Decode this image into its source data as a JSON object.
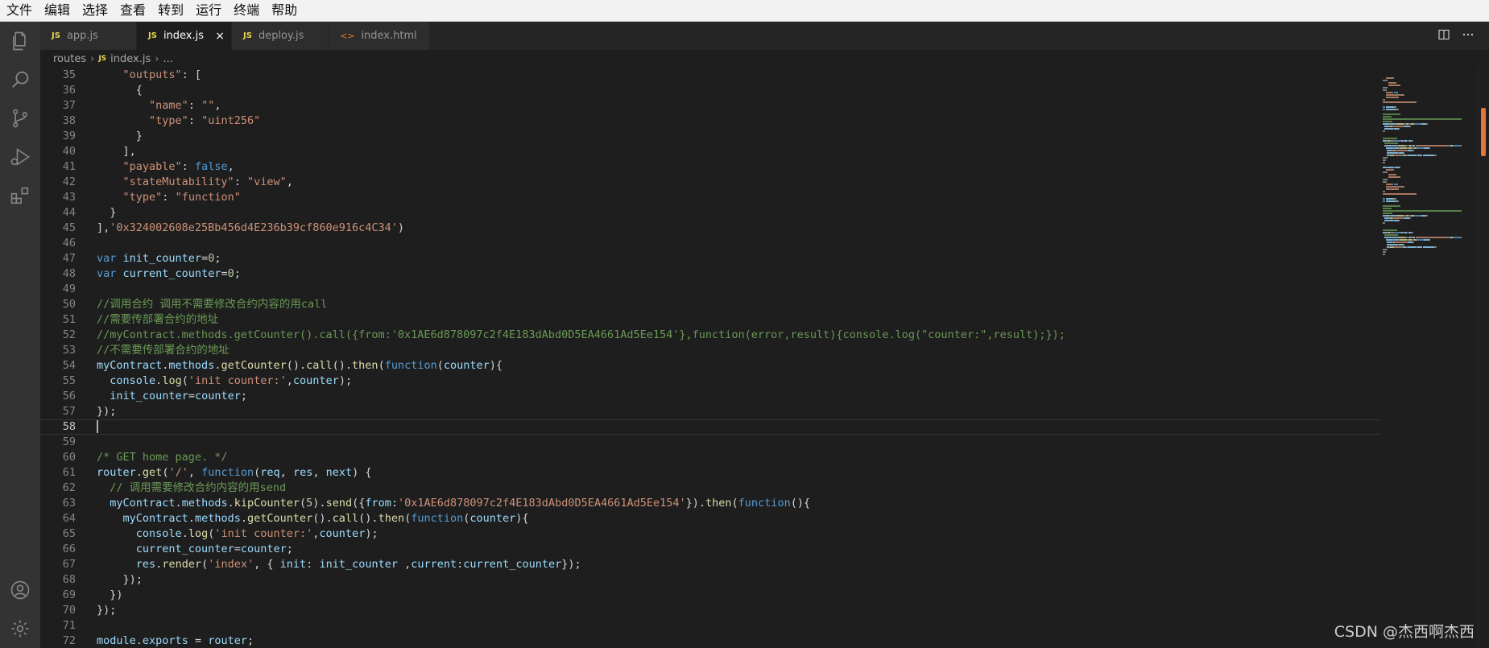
{
  "menu": [
    "文件",
    "编辑",
    "选择",
    "查看",
    "转到",
    "运行",
    "终端",
    "帮助"
  ],
  "tabs": [
    {
      "label": "app.js",
      "icon": "JS"
    },
    {
      "label": "index.js",
      "icon": "JS",
      "close": "×"
    },
    {
      "label": "deploy.js",
      "icon": "JS"
    },
    {
      "label": "index.html",
      "icon": "<>"
    }
  ],
  "breadcrumb": {
    "folder": "routes",
    "file_icon": "JS",
    "file": "index.js",
    "more": "..."
  },
  "lines": [
    {
      "n": "35",
      "segs": [
        [
          "    ",
          "p"
        ],
        [
          "\"outputs\"",
          "k"
        ],
        [
          ": [",
          "p"
        ]
      ]
    },
    {
      "n": "36",
      "segs": [
        [
          "      {",
          "p"
        ]
      ]
    },
    {
      "n": "37",
      "segs": [
        [
          "        ",
          "p"
        ],
        [
          "\"name\"",
          "k"
        ],
        [
          ": ",
          "p"
        ],
        [
          "\"\"",
          "s"
        ],
        [
          ",",
          "p"
        ]
      ]
    },
    {
      "n": "38",
      "segs": [
        [
          "        ",
          "p"
        ],
        [
          "\"type\"",
          "k"
        ],
        [
          ": ",
          "p"
        ],
        [
          "\"uint256\"",
          "s"
        ]
      ]
    },
    {
      "n": "39",
      "segs": [
        [
          "      }",
          "p"
        ]
      ]
    },
    {
      "n": "40",
      "segs": [
        [
          "    ],",
          "p"
        ]
      ]
    },
    {
      "n": "41",
      "segs": [
        [
          "    ",
          "p"
        ],
        [
          "\"payable\"",
          "k"
        ],
        [
          ": ",
          "p"
        ],
        [
          "false",
          "w"
        ],
        [
          ",",
          "p"
        ]
      ]
    },
    {
      "n": "42",
      "segs": [
        [
          "    ",
          "p"
        ],
        [
          "\"stateMutability\"",
          "k"
        ],
        [
          ": ",
          "p"
        ],
        [
          "\"view\"",
          "s"
        ],
        [
          ",",
          "p"
        ]
      ]
    },
    {
      "n": "43",
      "segs": [
        [
          "    ",
          "p"
        ],
        [
          "\"type\"",
          "k"
        ],
        [
          ": ",
          "p"
        ],
        [
          "\"function\"",
          "s"
        ]
      ]
    },
    {
      "n": "44",
      "segs": [
        [
          "  }",
          "p"
        ]
      ]
    },
    {
      "n": "45",
      "segs": [
        [
          "],",
          "p"
        ],
        [
          "'0x324002608e25Bb456d4E236b39cf860e916c4C34'",
          "s"
        ],
        [
          ")",
          "p"
        ]
      ]
    },
    {
      "n": "46",
      "segs": []
    },
    {
      "n": "47",
      "segs": [
        [
          "var",
          "w"
        ],
        [
          " ",
          "p"
        ],
        [
          "init_counter",
          "v"
        ],
        [
          "=",
          "p"
        ],
        [
          "0",
          "n"
        ],
        [
          ";",
          "p"
        ]
      ]
    },
    {
      "n": "48",
      "segs": [
        [
          "var",
          "w"
        ],
        [
          " ",
          "p"
        ],
        [
          "current_counter",
          "v"
        ],
        [
          "=",
          "p"
        ],
        [
          "0",
          "n"
        ],
        [
          ";",
          "p"
        ]
      ]
    },
    {
      "n": "49",
      "segs": []
    },
    {
      "n": "50",
      "segs": [
        [
          "//调用合约 调用不需要修改合约内容的用call",
          "c"
        ]
      ]
    },
    {
      "n": "51",
      "segs": [
        [
          "//需要传部署合约的地址",
          "c"
        ]
      ]
    },
    {
      "n": "52",
      "segs": [
        [
          "//myContract.methods.getCounter().call({from:'0x1AE6d878097c2f4E183dAbd0D5EA4661Ad5Ee154'},function(error,result){console.log(\"counter:\",result);});",
          "c"
        ]
      ]
    },
    {
      "n": "53",
      "segs": [
        [
          "//不需要传部署合约的地址",
          "c"
        ]
      ]
    },
    {
      "n": "54",
      "segs": [
        [
          "myContract",
          "v"
        ],
        [
          ".",
          "p"
        ],
        [
          "methods",
          "v"
        ],
        [
          ".",
          "p"
        ],
        [
          "getCounter",
          "f"
        ],
        [
          "().",
          "p"
        ],
        [
          "call",
          "f"
        ],
        [
          "().",
          "p"
        ],
        [
          "then",
          "f"
        ],
        [
          "(",
          "p"
        ],
        [
          "function",
          "w"
        ],
        [
          "(",
          "p"
        ],
        [
          "counter",
          "v"
        ],
        [
          "){",
          "p"
        ]
      ]
    },
    {
      "n": "55",
      "segs": [
        [
          "  ",
          "p"
        ],
        [
          "console",
          "v"
        ],
        [
          ".",
          "p"
        ],
        [
          "log",
          "f"
        ],
        [
          "(",
          "p"
        ],
        [
          "'init counter:'",
          "s"
        ],
        [
          ",",
          "p"
        ],
        [
          "counter",
          "v"
        ],
        [
          ");",
          "p"
        ]
      ]
    },
    {
      "n": "56",
      "segs": [
        [
          "  ",
          "p"
        ],
        [
          "init_counter",
          "v"
        ],
        [
          "=",
          "p"
        ],
        [
          "counter",
          "v"
        ],
        [
          ";",
          "p"
        ]
      ]
    },
    {
      "n": "57",
      "segs": [
        [
          "});",
          "p"
        ]
      ]
    },
    {
      "n": "58",
      "segs": [],
      "current": true
    },
    {
      "n": "59",
      "segs": []
    },
    {
      "n": "60",
      "segs": [
        [
          "/* GET home page. */",
          "c"
        ]
      ]
    },
    {
      "n": "61",
      "segs": [
        [
          "router",
          "v"
        ],
        [
          ".",
          "p"
        ],
        [
          "get",
          "f"
        ],
        [
          "(",
          "p"
        ],
        [
          "'/'",
          "s"
        ],
        [
          ", ",
          "p"
        ],
        [
          "function",
          "w"
        ],
        [
          "(",
          "p"
        ],
        [
          "req",
          "v"
        ],
        [
          ", ",
          "p"
        ],
        [
          "res",
          "v"
        ],
        [
          ", ",
          "p"
        ],
        [
          "next",
          "v"
        ],
        [
          ") {",
          "p"
        ]
      ]
    },
    {
      "n": "62",
      "segs": [
        [
          "  ",
          "p"
        ],
        [
          "// 调用需要修改合约内容的用send",
          "c"
        ]
      ]
    },
    {
      "n": "63",
      "segs": [
        [
          "  ",
          "p"
        ],
        [
          "myContract",
          "v"
        ],
        [
          ".",
          "p"
        ],
        [
          "methods",
          "v"
        ],
        [
          ".",
          "p"
        ],
        [
          "kipCounter",
          "f"
        ],
        [
          "(",
          "p"
        ],
        [
          "5",
          "n"
        ],
        [
          ").",
          "p"
        ],
        [
          "send",
          "f"
        ],
        [
          "({",
          "p"
        ],
        [
          "from",
          "v"
        ],
        [
          ":",
          "p"
        ],
        [
          "'0x1AE6d878097c2f4E183dAbd0D5EA4661Ad5Ee154'",
          "s"
        ],
        [
          "}).",
          "p"
        ],
        [
          "then",
          "f"
        ],
        [
          "(",
          "p"
        ],
        [
          "function",
          "w"
        ],
        [
          "(){",
          "p"
        ]
      ]
    },
    {
      "n": "64",
      "segs": [
        [
          "    ",
          "p"
        ],
        [
          "myContract",
          "v"
        ],
        [
          ".",
          "p"
        ],
        [
          "methods",
          "v"
        ],
        [
          ".",
          "p"
        ],
        [
          "getCounter",
          "f"
        ],
        [
          "().",
          "p"
        ],
        [
          "call",
          "f"
        ],
        [
          "().",
          "p"
        ],
        [
          "then",
          "f"
        ],
        [
          "(",
          "p"
        ],
        [
          "function",
          "w"
        ],
        [
          "(",
          "p"
        ],
        [
          "counter",
          "v"
        ],
        [
          "){",
          "p"
        ]
      ]
    },
    {
      "n": "65",
      "segs": [
        [
          "      ",
          "p"
        ],
        [
          "console",
          "v"
        ],
        [
          ".",
          "p"
        ],
        [
          "log",
          "f"
        ],
        [
          "(",
          "p"
        ],
        [
          "'init counter:'",
          "s"
        ],
        [
          ",",
          "p"
        ],
        [
          "counter",
          "v"
        ],
        [
          ");",
          "p"
        ]
      ]
    },
    {
      "n": "66",
      "segs": [
        [
          "      ",
          "p"
        ],
        [
          "current_counter",
          "v"
        ],
        [
          "=",
          "p"
        ],
        [
          "counter",
          "v"
        ],
        [
          ";",
          "p"
        ]
      ]
    },
    {
      "n": "67",
      "segs": [
        [
          "      ",
          "p"
        ],
        [
          "res",
          "v"
        ],
        [
          ".",
          "p"
        ],
        [
          "render",
          "f"
        ],
        [
          "(",
          "p"
        ],
        [
          "'index'",
          "s"
        ],
        [
          ", { ",
          "p"
        ],
        [
          "init",
          "v"
        ],
        [
          ": ",
          "p"
        ],
        [
          "init_counter",
          "v"
        ],
        [
          " ,",
          "p"
        ],
        [
          "current",
          "v"
        ],
        [
          ":",
          "p"
        ],
        [
          "current_counter",
          "v"
        ],
        [
          "});",
          "p"
        ]
      ]
    },
    {
      "n": "68",
      "segs": [
        [
          "    });",
          "p"
        ]
      ]
    },
    {
      "n": "69",
      "segs": [
        [
          "  })",
          "p"
        ]
      ]
    },
    {
      "n": "70",
      "segs": [
        [
          "});",
          "p"
        ]
      ]
    },
    {
      "n": "71",
      "segs": []
    },
    {
      "n": "72",
      "segs": [
        [
          "module",
          "v"
        ],
        [
          ".",
          "p"
        ],
        [
          "exports",
          "v"
        ],
        [
          " = ",
          "p"
        ],
        [
          "router",
          "v"
        ],
        [
          ";",
          "p"
        ]
      ]
    }
  ],
  "watermark": "CSDN @杰西啊杰西",
  "colors": {
    "accent": "#e0763a",
    "editor_bg": "#1e1e1e",
    "activity_bg": "#333333"
  }
}
